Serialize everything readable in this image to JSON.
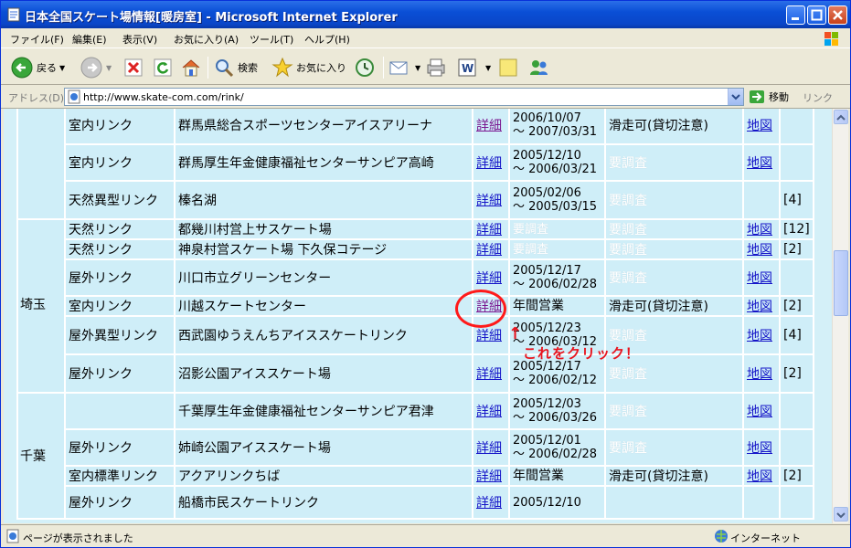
{
  "window": {
    "title": "日本全国スケート場情報[暖房室] - Microsoft Internet Explorer"
  },
  "menu": [
    "ファイル(F)",
    "編集(E)",
    "表示(V)",
    "お気に入り(A)",
    "ツール(T)",
    "ヘルプ(H)"
  ],
  "toolbar": {
    "back": "戻る",
    "search": "検索",
    "favorites": "お気に入り"
  },
  "address": {
    "label": "アドレス(D)",
    "url": "http://www.skate-com.com/rink/",
    "go": "移動",
    "links": "リンク"
  },
  "rows": [
    {
      "pref": "",
      "type": "室内リンク",
      "name": "群馬県総合スポーツセンターアイスアリーナ",
      "detail": "詳細",
      "visited": true,
      "d1": "2006/10/07",
      "d2": "～ 2007/03/31",
      "status": "滑走可(貸切注意)",
      "unk": false,
      "map": "地図",
      "num": ""
    },
    {
      "pref": "",
      "type": "室内リンク",
      "name": "群馬厚生年金健康福祉センターサンピア高崎",
      "detail": "詳細",
      "visited": false,
      "d1": "2005/12/10",
      "d2": "～ 2006/03/21",
      "status": "要調査",
      "unk": true,
      "map": "地図",
      "num": ""
    },
    {
      "pref": "",
      "type": "天然異型リンク",
      "name": "榛名湖",
      "detail": "詳細",
      "visited": false,
      "d1": "2005/02/06",
      "d2": "～ 2005/03/15",
      "status": "要調査",
      "unk": true,
      "map": "",
      "num": "[4]"
    },
    {
      "pref": "",
      "type": "天然リンク",
      "name": "都幾川村営上サスケート場",
      "detail": "詳細",
      "visited": false,
      "d1": "要調査",
      "d2": "",
      "status": "要調査",
      "unk": true,
      "map": "地図",
      "num": "[12]"
    },
    {
      "pref": "",
      "type": "天然リンク",
      "name": "神泉村営スケート場 下久保コテージ",
      "detail": "詳細",
      "visited": false,
      "d1": "要調査",
      "d2": "",
      "status": "要調査",
      "unk": true,
      "map": "地図",
      "num": "[2]"
    },
    {
      "pref": "",
      "type": "屋外リンク",
      "name": "川口市立グリーンセンター",
      "detail": "詳細",
      "visited": false,
      "d1": "2005/12/17",
      "d2": "～ 2006/02/28",
      "status": "要調査",
      "unk": true,
      "map": "地図",
      "num": ""
    },
    {
      "pref": "埼玉",
      "type": "室内リンク",
      "name": "川越スケートセンター",
      "detail": "詳細",
      "visited": true,
      "d1": "年間営業",
      "d2": "",
      "status": "滑走可(貸切注意)",
      "unk": false,
      "map": "地図",
      "num": "[2]"
    },
    {
      "pref": "",
      "type": "屋外異型リンク",
      "name": "西武園ゆうえんちアイススケートリンク",
      "detail": "詳細",
      "visited": false,
      "d1": "2005/12/23",
      "d2": "～ 2006/03/12",
      "status": "要調査",
      "unk": true,
      "map": "地図",
      "num": "[4]"
    },
    {
      "pref": "",
      "type": "屋外リンク",
      "name": "沼影公園アイススケート場",
      "detail": "詳細",
      "visited": false,
      "d1": "2005/12/17",
      "d2": "～ 2006/02/12",
      "status": "要調査",
      "unk": true,
      "map": "地図",
      "num": "[2]"
    },
    {
      "pref": "",
      "type": "",
      "name": "千葉厚生年金健康福祉センターサンピア君津",
      "detail": "詳細",
      "visited": false,
      "d1": "2005/12/03",
      "d2": "～ 2006/03/26",
      "status": "要調査",
      "unk": true,
      "map": "地図",
      "num": ""
    },
    {
      "pref": "千葉",
      "type": "屋外リンク",
      "name": "姉崎公園アイススケート場",
      "detail": "詳細",
      "visited": false,
      "d1": "2005/12/01",
      "d2": "～ 2006/02/28",
      "status": "要調査",
      "unk": true,
      "map": "地図",
      "num": ""
    },
    {
      "pref": "",
      "type": "室内標準リンク",
      "name": "アクアリンクちば",
      "detail": "詳細",
      "visited": false,
      "d1": "年間営業",
      "d2": "",
      "status": "滑走可(貸切注意)",
      "unk": false,
      "map": "地図",
      "num": "[2]"
    },
    {
      "pref": "",
      "type": "屋外リンク",
      "name": "船橋市民スケートリンク",
      "detail": "詳細",
      "visited": false,
      "d1": "2005/12/10",
      "d2": "",
      "status": "",
      "unk": true,
      "map": "",
      "num": ""
    }
  ],
  "annotation": {
    "arrow": "↑",
    "text": "これをクリック！"
  },
  "status": {
    "text": "ページが表示されました",
    "zone": "インターネット"
  },
  "colors": {
    "cell": "#cfeef8",
    "link": "#1515c8",
    "visited": "#7a1690",
    "annot": "#e8141e"
  }
}
